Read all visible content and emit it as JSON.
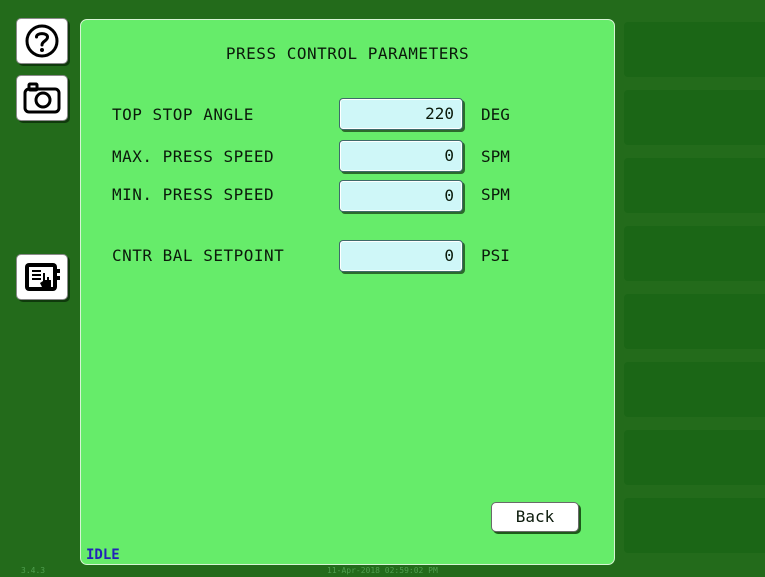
{
  "sidebar": {
    "help_icon": "help-circle-icon",
    "camera_icon": "camera-icon",
    "touch_icon": "touchscreen-hand-icon"
  },
  "panel": {
    "title": "PRESS CONTROL PARAMETERS",
    "params": [
      {
        "label": "TOP STOP ANGLE",
        "value": "220",
        "unit": "DEG"
      },
      {
        "label": "MAX. PRESS SPEED",
        "value": "0",
        "unit": "SPM"
      },
      {
        "label": "MIN. PRESS SPEED",
        "value": "0",
        "unit": "SPM"
      },
      {
        "label": "CNTR BAL SETPOINT",
        "value": "0",
        "unit": "PSI"
      }
    ],
    "back_label": "Back",
    "status": "IDLE"
  },
  "footer": {
    "version": "3.4.3",
    "datetime": "11-Apr-2018 02:59:02 PM"
  },
  "colors": {
    "background": "#236b1b",
    "panel": "#66ec6a",
    "field": "#cff7f8",
    "right_buttons": "#1b6616",
    "status_text": "#2323b8"
  }
}
